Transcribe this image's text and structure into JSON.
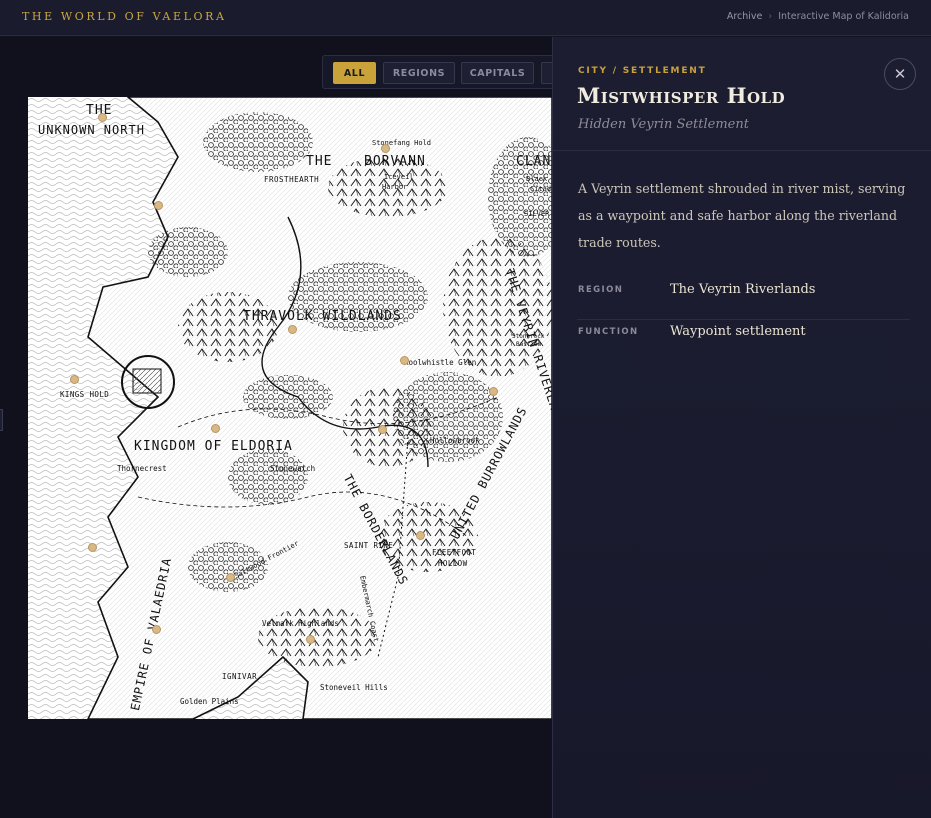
{
  "header": {
    "brand": "THE WORLD OF VAELORA",
    "breadcrumb": [
      "Archive",
      "Interactive Map of Kalidoria"
    ]
  },
  "filters": [
    "ALL",
    "REGIONS",
    "CAPITALS"
  ],
  "active_filter": "ALL",
  "map": {
    "labels": [
      "THE",
      "UNKNOWN NORTH",
      "THE",
      "BORVANN",
      "CLAN",
      "Stonefang Hold",
      "Iceveil",
      "Harbor",
      "FROSTHEARTH",
      "Black",
      "Citad",
      "SILVER",
      "THRAVOLK WILDLANDS",
      "Stonerock",
      "Bastion",
      "Roolwhistle Glen",
      "KINGS HOLD",
      "KINGDOM OF ELDORIA",
      "Hollowbrook",
      "Thornecrest",
      "Stonewatch",
      "THE BORDERLANDS",
      "UNITED BURROWLANDS",
      "Saltwood Frontier",
      "SAINT RINE",
      "FLEETFOOT",
      "HOLLOW",
      "Embermarch Coast",
      "EMPIRE OF VALAEDRIA",
      "Velmark Highlands",
      "IGNIVAR",
      "Stoneveil Hills",
      "Golden Plains",
      "THE VEYRIN RIVERLANDS"
    ],
    "colors": {
      "ink": "#111111",
      "paper": "#ffffff",
      "marker": "#d8b986"
    }
  },
  "detail": {
    "kicker": "CITY / SETTLEMENT",
    "title": "Mistwhisper Hold",
    "subtitle": "Hidden Veyrin Settlement",
    "description": "A Veyrin settlement shrouded in river mist, serving as a waypoint and safe harbor along the riverland trade routes.",
    "fields": [
      {
        "key": "REGION",
        "value": "The Veyrin Riverlands"
      },
      {
        "key": "FUNCTION",
        "value": "Waypoint settlement"
      }
    ],
    "close_icon": "close-icon"
  },
  "colors": {
    "accent": "#c9a23a",
    "panel": "#1c1d31",
    "background": "#12131f"
  }
}
